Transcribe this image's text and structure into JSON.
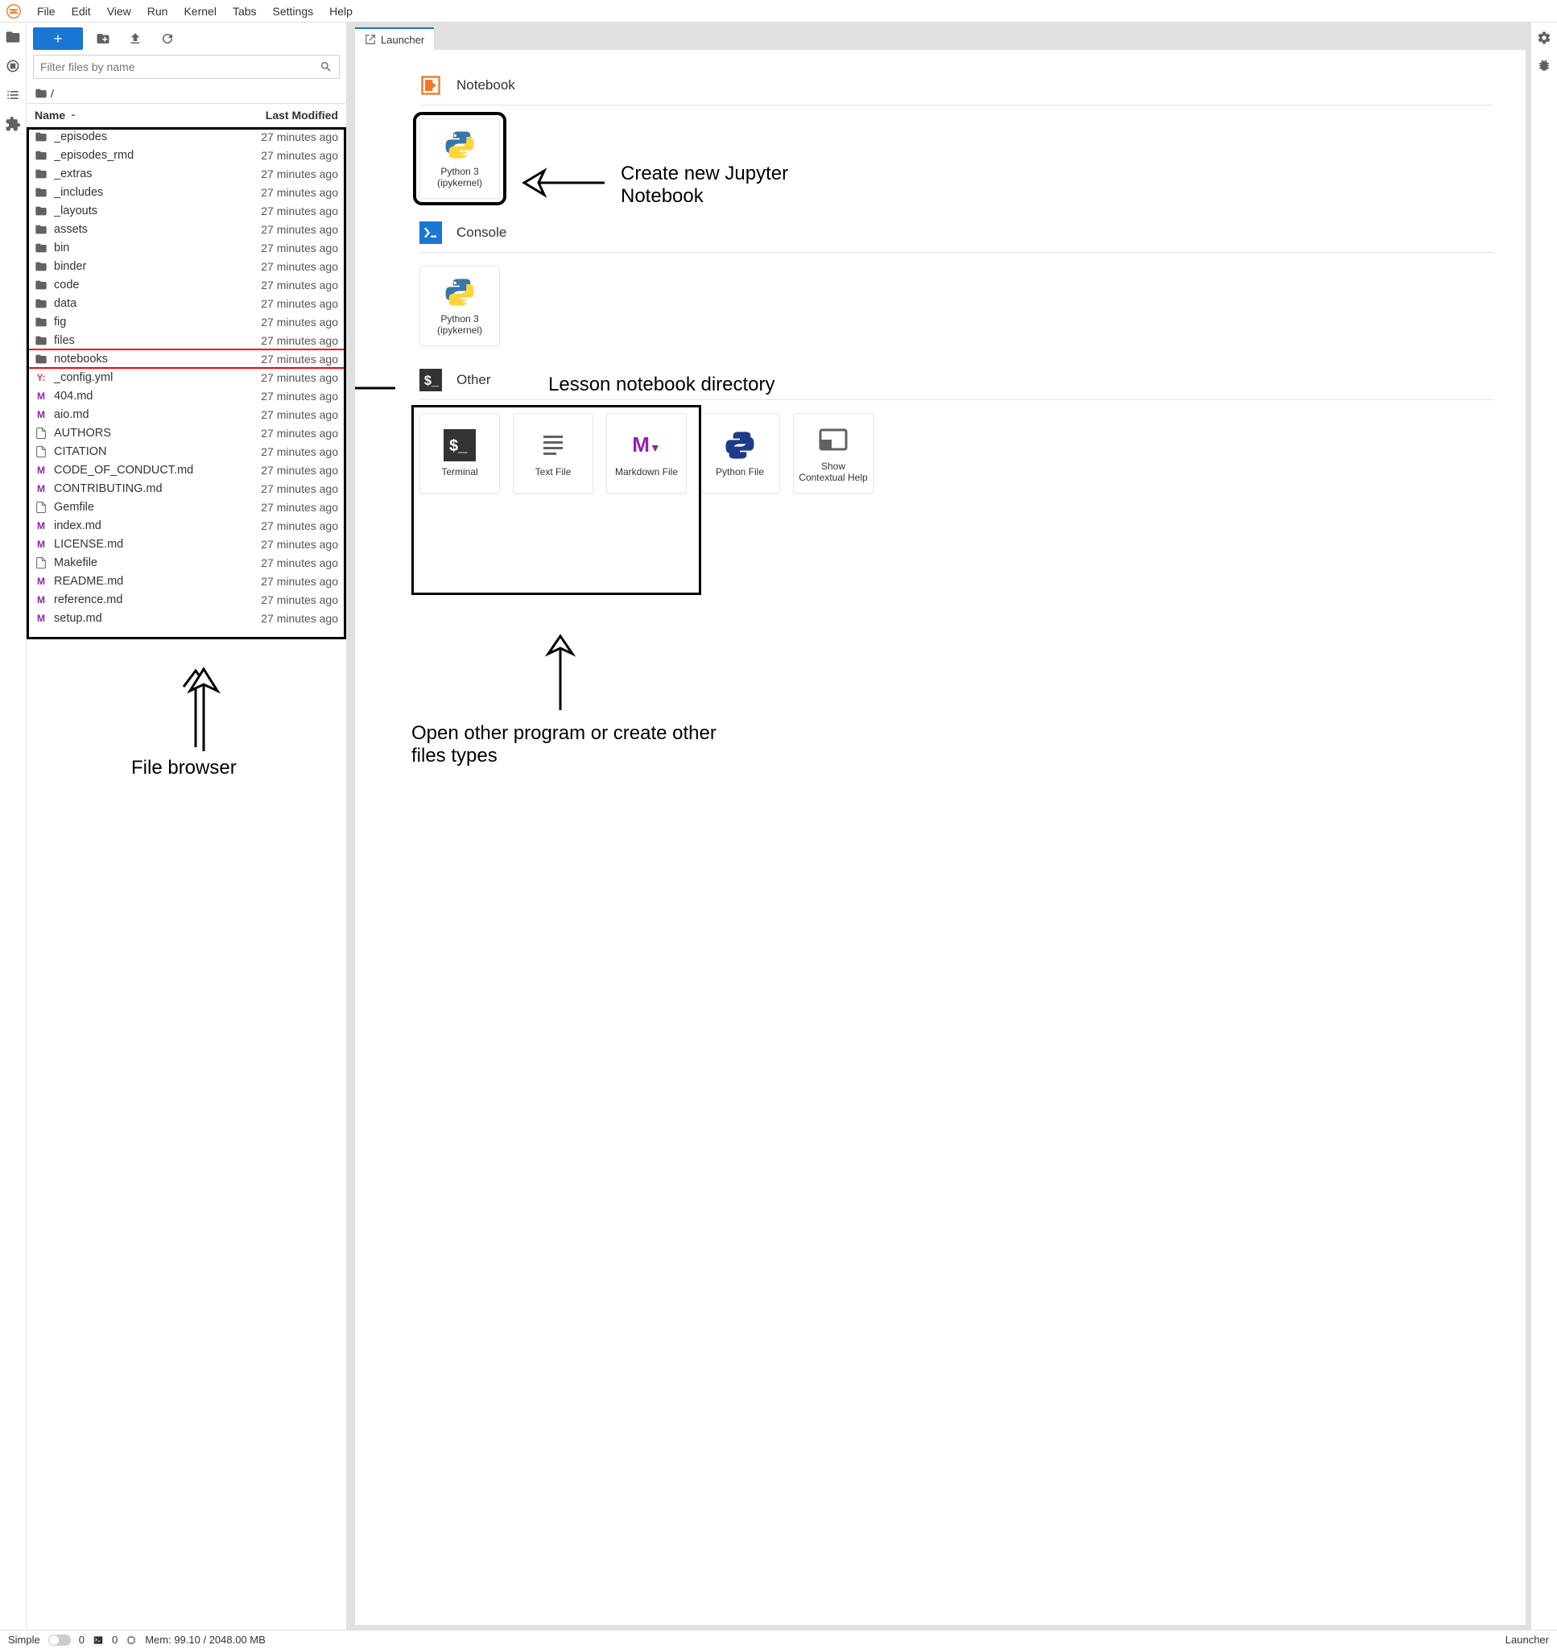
{
  "menu": [
    "File",
    "Edit",
    "View",
    "Run",
    "Kernel",
    "Tabs",
    "Settings",
    "Help"
  ],
  "filter_placeholder": "Filter files by name",
  "breadcrumb_root": "/",
  "columns": {
    "name": "Name",
    "modified": "Last Modified"
  },
  "files": [
    {
      "icon": "folder",
      "name": "_episodes",
      "modified": "27 minutes ago"
    },
    {
      "icon": "folder",
      "name": "_episodes_rmd",
      "modified": "27 minutes ago"
    },
    {
      "icon": "folder",
      "name": "_extras",
      "modified": "27 minutes ago"
    },
    {
      "icon": "folder",
      "name": "_includes",
      "modified": "27 minutes ago"
    },
    {
      "icon": "folder",
      "name": "_layouts",
      "modified": "27 minutes ago"
    },
    {
      "icon": "folder",
      "name": "assets",
      "modified": "27 minutes ago"
    },
    {
      "icon": "folder",
      "name": "bin",
      "modified": "27 minutes ago"
    },
    {
      "icon": "folder",
      "name": "binder",
      "modified": "27 minutes ago"
    },
    {
      "icon": "folder",
      "name": "code",
      "modified": "27 minutes ago"
    },
    {
      "icon": "folder",
      "name": "data",
      "modified": "27 minutes ago"
    },
    {
      "icon": "folder",
      "name": "fig",
      "modified": "27 minutes ago"
    },
    {
      "icon": "folder",
      "name": "files",
      "modified": "27 minutes ago"
    },
    {
      "icon": "folder",
      "name": "notebooks",
      "modified": "27 minutes ago",
      "highlight": true
    },
    {
      "icon": "yaml",
      "name": "_config.yml",
      "modified": "27 minutes ago"
    },
    {
      "icon": "markdown",
      "name": "404.md",
      "modified": "27 minutes ago"
    },
    {
      "icon": "markdown",
      "name": "aio.md",
      "modified": "27 minutes ago"
    },
    {
      "icon": "file",
      "name": "AUTHORS",
      "modified": "27 minutes ago"
    },
    {
      "icon": "file",
      "name": "CITATION",
      "modified": "27 minutes ago"
    },
    {
      "icon": "markdown",
      "name": "CODE_OF_CONDUCT.md",
      "modified": "27 minutes ago"
    },
    {
      "icon": "markdown",
      "name": "CONTRIBUTING.md",
      "modified": "27 minutes ago"
    },
    {
      "icon": "file",
      "name": "Gemfile",
      "modified": "27 minutes ago"
    },
    {
      "icon": "markdown",
      "name": "index.md",
      "modified": "27 minutes ago"
    },
    {
      "icon": "markdown",
      "name": "LICENSE.md",
      "modified": "27 minutes ago"
    },
    {
      "icon": "file",
      "name": "Makefile",
      "modified": "27 minutes ago"
    },
    {
      "icon": "markdown",
      "name": "README.md",
      "modified": "27 minutes ago"
    },
    {
      "icon": "markdown",
      "name": "reference.md",
      "modified": "27 minutes ago"
    },
    {
      "icon": "markdown",
      "name": "setup.md",
      "modified": "27 minutes ago"
    }
  ],
  "tab_label": "Launcher",
  "launcher": {
    "sections": [
      {
        "title": "Notebook",
        "icon": "notebook",
        "cards": [
          {
            "icon": "python",
            "label": "Python 3 (ipykernel)"
          }
        ],
        "highlight_card": true
      },
      {
        "title": "Console",
        "icon": "console",
        "cards": [
          {
            "icon": "python",
            "label": "Python 3 (ipykernel)"
          }
        ]
      },
      {
        "title": "Other",
        "icon": "terminal",
        "cards": [
          {
            "icon": "terminal-card",
            "label": "Terminal"
          },
          {
            "icon": "textfile",
            "label": "Text File"
          },
          {
            "icon": "markdownfile",
            "label": "Markdown File"
          },
          {
            "icon": "pythonfile",
            "label": "Python File"
          },
          {
            "icon": "help",
            "label": "Show Contextual Help"
          }
        ],
        "highlight_group": true
      }
    ]
  },
  "annotations": {
    "file_browser": "File browser",
    "create_notebook": "Create new Jupyter Notebook",
    "lesson_dir": "Lesson notebook directory",
    "other_programs": "Open other program or create other files types"
  },
  "statusbar": {
    "simple": "Simple",
    "count1": "0",
    "count2": "0",
    "mem": "Mem: 99.10 / 2048.00 MB",
    "right": "Launcher"
  }
}
